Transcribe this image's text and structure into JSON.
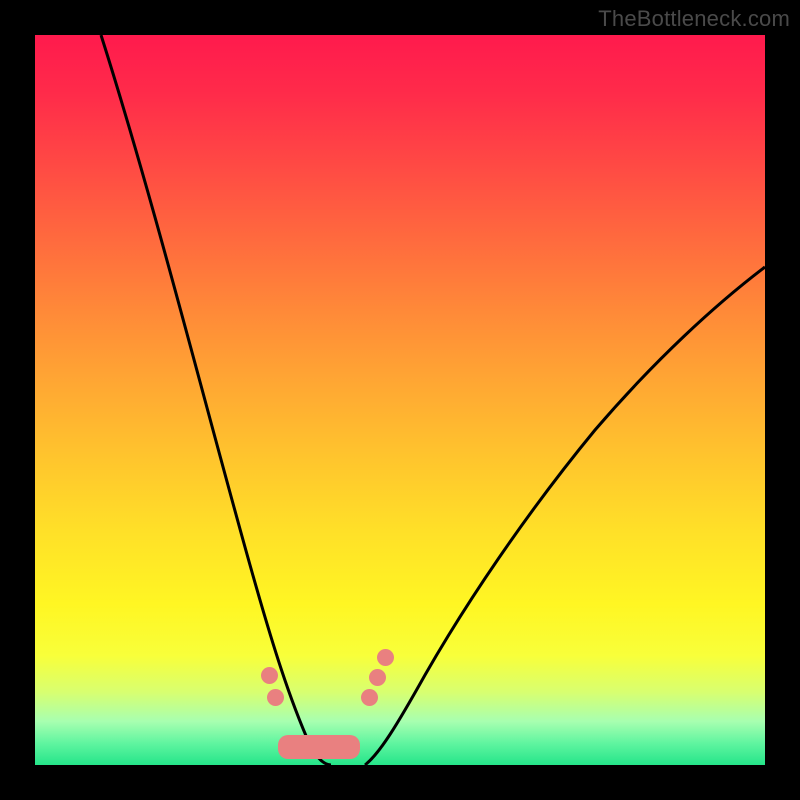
{
  "watermark": "TheBottleneck.com",
  "chart_data": {
    "type": "line",
    "title": "",
    "xlabel": "",
    "ylabel": "",
    "xlim": [
      0,
      100
    ],
    "ylim": [
      0,
      100
    ],
    "grid": false,
    "series": [
      {
        "name": "left-curve",
        "x": [
          10,
          15,
          20,
          25,
          28,
          30,
          32,
          34,
          36,
          38,
          40
        ],
        "y": [
          100,
          80,
          60,
          40,
          28,
          20,
          14,
          9,
          5,
          2,
          0
        ]
      },
      {
        "name": "right-curve",
        "x": [
          45,
          48,
          52,
          58,
          66,
          76,
          88,
          100
        ],
        "y": [
          0,
          3,
          8,
          17,
          30,
          45,
          58,
          68
        ]
      }
    ],
    "highlight_region": {
      "name": "optimal-band",
      "dots": [
        {
          "x": 32,
          "y": 12
        },
        {
          "x": 32.8,
          "y": 9
        },
        {
          "x": 45.2,
          "y": 9.5
        },
        {
          "x": 46,
          "y": 12.5
        },
        {
          "x": 47,
          "y": 15.5
        }
      ],
      "bar": {
        "x_start": 34,
        "x_end": 44,
        "y": 3.2,
        "height": 3.5
      }
    },
    "gradient_meaning": "top-red=high-bottleneck, bottom-green=optimal"
  }
}
